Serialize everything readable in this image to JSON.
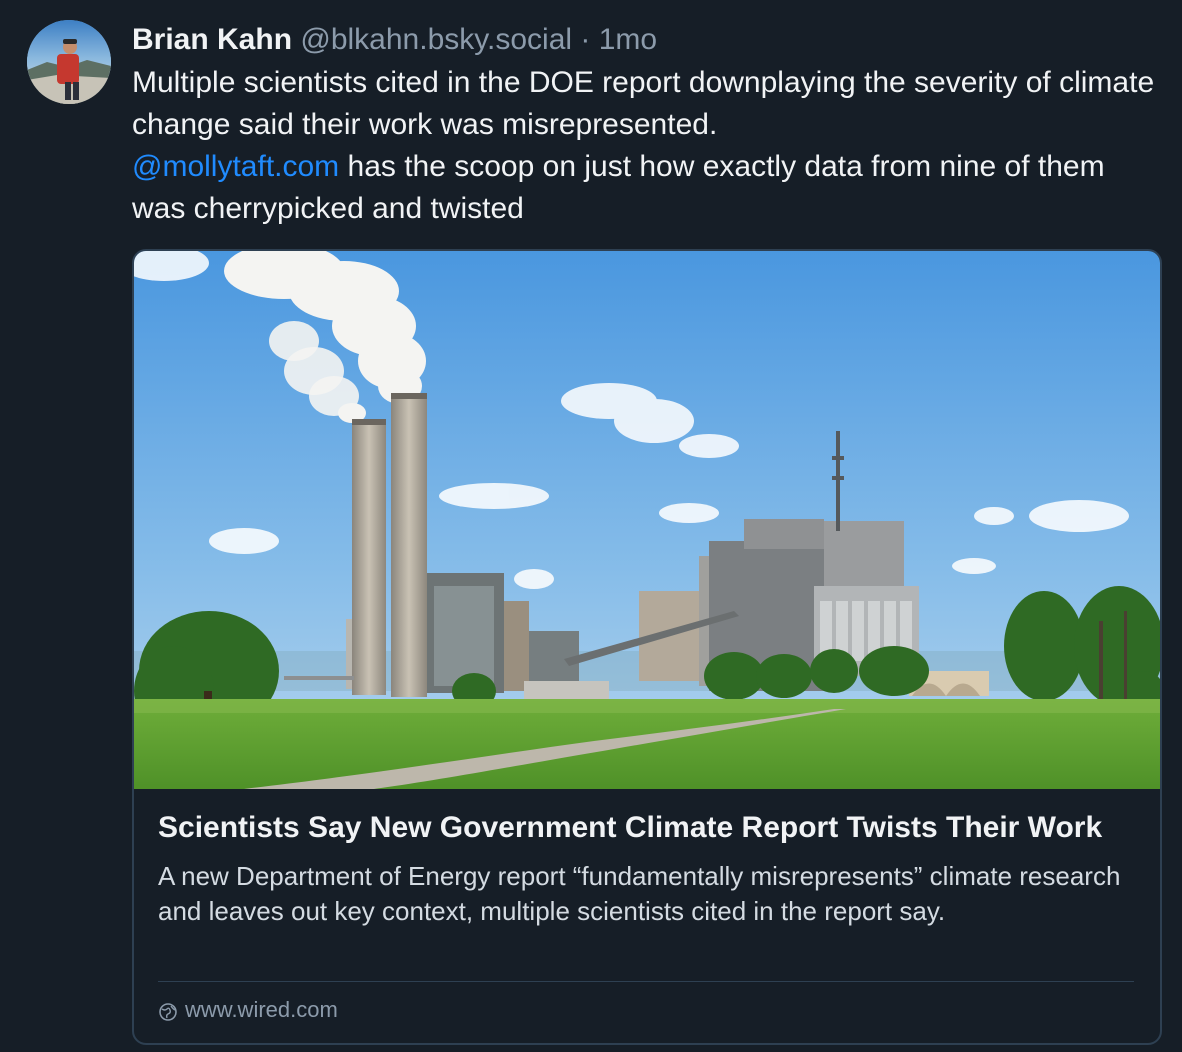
{
  "post": {
    "author": {
      "name": "Brian Kahn",
      "handle": "@blkahn.bsky.social"
    },
    "separator": "·",
    "time": "1mo",
    "text_line1": "Multiple scientists cited in the DOE report downplaying the severity of climate change said their work was misrepresented.",
    "mention": "@mollytaft.com",
    "text_line2": " has the scoop on just how exactly data from nine of them was cherrypicked and twisted"
  },
  "link_card": {
    "image_icon": "power-plant-photo",
    "title": "Scientists Say New Government Climate Report Twists Their Work",
    "description": "A new Department of Energy report “fundamentally misrepresents” climate research and leaves out key context, multiple scientists cited in the report say.",
    "domain_icon": "globe-icon",
    "domain": "www.wired.com"
  },
  "colors": {
    "background": "#161e27",
    "text": "#f1f3f5",
    "muted": "#8c9bab",
    "link": "#208bfe",
    "border": "#2e4052"
  }
}
